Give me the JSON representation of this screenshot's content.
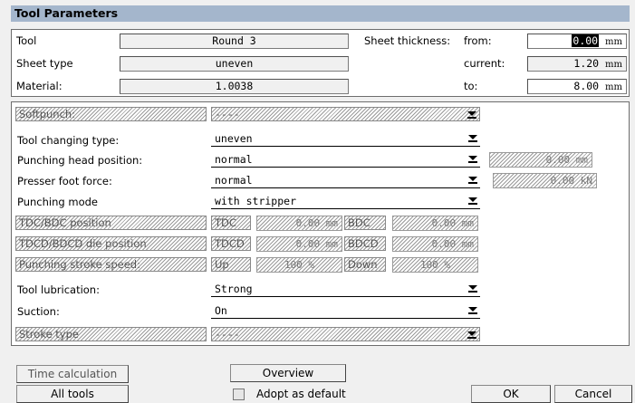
{
  "title": "Tool Parameters",
  "info": {
    "tool_label": "Tool",
    "tool_value": "Round 3",
    "sheet_type_label": "Sheet type",
    "sheet_type_value": "uneven",
    "material_label": "Material:",
    "material_value": "1.0038",
    "thickness_label": "Sheet thickness:",
    "from_label": "from:",
    "from_value": "0.00",
    "current_label": "current:",
    "current_value": "1.20",
    "to_label": "to:",
    "to_value": "8.00",
    "unit_mm": "mm"
  },
  "params": {
    "softpunch_label": "Softpunch:",
    "softpunch_value": "----",
    "tool_changing_label": "Tool changing type:",
    "tool_changing_value": "uneven",
    "punching_head_label": "Punching head position:",
    "punching_head_value": "normal",
    "punching_head_extra": "0.00 mm",
    "presser_label": "Presser foot force:",
    "presser_value": "normal",
    "presser_extra": "0.00 kN",
    "punching_mode_label": "Punching mode",
    "punching_mode_value": "with stripper",
    "tdc_label": "TDC/BDC position",
    "tdc_a": "TDC",
    "tdc_a_val": "0.00 mm",
    "tdc_b": "BDC",
    "tdc_b_val": "0.00 mm",
    "tdcd_label": "TDCD/BDCD die position",
    "tdcd_a": "TDCD",
    "tdcd_a_val": "0.00 mm",
    "tdcd_b": "BDCD",
    "tdcd_b_val": "0.00 mm",
    "speed_label": "Punching stroke speed:",
    "speed_a": "Up",
    "speed_a_val": "100 %",
    "speed_b": "Down",
    "speed_b_val": "100 %",
    "lubrication_label": "Tool lubrication:",
    "lubrication_value": "Strong",
    "suction_label": "Suction:",
    "suction_value": "On",
    "stroke_type_label": "Stroke type",
    "stroke_type_value": "----"
  },
  "buttons": {
    "time_calc": "Time calculation",
    "overview": "Overview",
    "all_tools": "All tools",
    "adopt_default": "Adopt as default",
    "ok": "OK",
    "cancel": "Cancel"
  }
}
